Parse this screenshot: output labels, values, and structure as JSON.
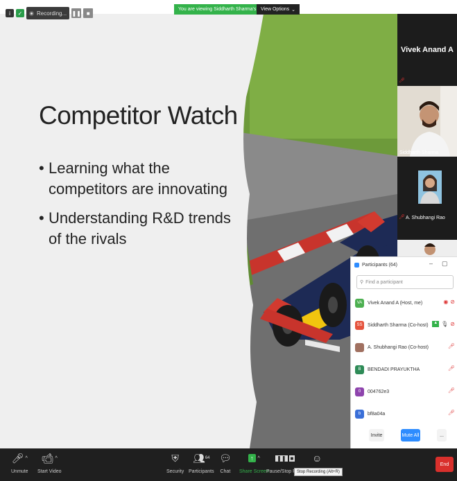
{
  "topbar": {
    "recording_label": "Recording...",
    "viewing_text": "You are viewing Siddharth Sharma's screen",
    "view_options": "View Options"
  },
  "slide": {
    "title": "Competitor Watch",
    "bullets": [
      "Learning what the competitors are innovating",
      "Understanding R&D trends of the rivals"
    ]
  },
  "video": {
    "active_name": "Vivek Anand A",
    "tiles": [
      {
        "label": "Siddharth Sharma"
      },
      {
        "label": "A. Shubhangi Rao"
      }
    ]
  },
  "participants": {
    "title": "Participants (64)",
    "search_placeholder": "Find a participant",
    "rows": [
      {
        "initials": "VA",
        "name": "Vivek Anand A (Host, me)",
        "color": "#4caf50"
      },
      {
        "initials": "SS",
        "name": "Siddharth Sharma (Co-host)",
        "color": "#e5533d"
      },
      {
        "initials": "",
        "name": "A. Shubhangi Rao (Co-host)",
        "color": "#a07060"
      },
      {
        "initials": "B",
        "name": "BENDADI PRAYUKTHA",
        "color": "#2e8b57"
      },
      {
        "initials": "0",
        "name": "004762e3",
        "color": "#8e44ad"
      },
      {
        "initials": "b",
        "name": "bf8a04a",
        "color": "#3a6fd8"
      }
    ],
    "invite_label": "Invite",
    "mute_all_label": "Mute All",
    "more_label": "..."
  },
  "toolbar": {
    "unmute": "Unmute",
    "start_video": "Start Video",
    "security": "Security",
    "participants": "Participants",
    "participants_count": "64",
    "chat": "Chat",
    "share_screen": "Share Screen",
    "pause_stop": "Pause/Stop Reco",
    "stop_recording_tooltip": "Stop Recording (Alt+R)",
    "end": "End"
  },
  "colors": {
    "accent_green": "#33b24a",
    "end_red": "#d9302c",
    "mute_blue": "#2d8cff"
  }
}
